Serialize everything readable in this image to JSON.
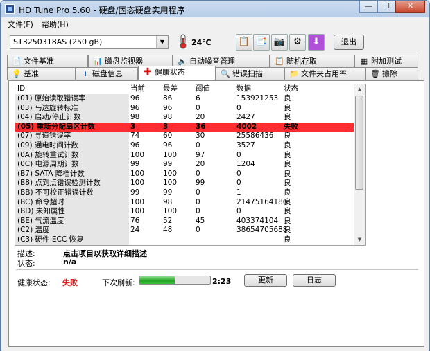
{
  "window": {
    "title": "HD Tune Pro 5.60 - 硬盘/固态硬盘实用程序"
  },
  "menu": {
    "file": "文件(F)",
    "help": "帮助(H)"
  },
  "toolbar": {
    "drive": "ST3250318AS (250 gB)",
    "temperature": "24℃",
    "exit_label": "退出"
  },
  "tabs_top": [
    {
      "label": "文件基准",
      "icon": "file-benchmark-icon"
    },
    {
      "label": "磁盘监视器",
      "icon": "disk-monitor-icon"
    },
    {
      "label": "自动噪音管理",
      "icon": "speaker-icon"
    },
    {
      "label": "随机存取",
      "icon": "random-access-icon"
    },
    {
      "label": "附加测试",
      "icon": "extra-tests-icon"
    }
  ],
  "tabs_bottom": [
    {
      "label": "基准",
      "icon": "lightbulb-icon"
    },
    {
      "label": "磁盘信息",
      "icon": "info-icon"
    },
    {
      "label": "健康状态",
      "icon": "red-cross-icon",
      "active": true
    },
    {
      "label": "错误扫描",
      "icon": "magnifier-icon"
    },
    {
      "label": "文件夹占用率",
      "icon": "folder-icon"
    },
    {
      "label": "擦除",
      "icon": "trash-icon"
    }
  ],
  "table": {
    "headers": [
      "ID",
      "当前",
      "最差",
      "阈值",
      "数据",
      "状态"
    ],
    "rows": [
      [
        "(01) 原始读取错误率",
        "96",
        "86",
        "6",
        "153921253",
        "良"
      ],
      [
        "(03) 马达旋转标准",
        "96",
        "96",
        "0",
        "0",
        "良"
      ],
      [
        "(04) 启动/停止计数",
        "98",
        "98",
        "20",
        "2427",
        "良"
      ],
      [
        "(05) 重新分配扇区计数",
        "3",
        "3",
        "36",
        "4002",
        "失败"
      ],
      [
        "(07) 寻道错误率",
        "74",
        "60",
        "30",
        "25586436",
        "良"
      ],
      [
        "(09) 通电时间计数",
        "96",
        "96",
        "0",
        "3527",
        "良"
      ],
      [
        "(0A) 旋转重试计数",
        "100",
        "100",
        "97",
        "0",
        "良"
      ],
      [
        "(0C) 电源周期计数",
        "99",
        "99",
        "20",
        "1204",
        "良"
      ],
      [
        "(B7) SATA 降档计数",
        "100",
        "100",
        "0",
        "0",
        "良"
      ],
      [
        "(B8) 点到点错误检测计数",
        "100",
        "100",
        "99",
        "0",
        "良"
      ],
      [
        "(BB) 不可校正错误计数",
        "99",
        "99",
        "0",
        "1",
        "良"
      ],
      [
        "(BC) 命令超时",
        "100",
        "98",
        "0",
        "21475164186",
        "良"
      ],
      [
        "(BD) 未知属性",
        "100",
        "100",
        "0",
        "0",
        "良"
      ],
      [
        "(BE) 气流温度",
        "76",
        "52",
        "45",
        "403374104",
        "良"
      ],
      [
        "(C2) 温度",
        "24",
        "48",
        "0",
        "38654705688",
        "良"
      ],
      [
        "(C3) 硬件 ECC 恢复",
        "",
        "",
        "",
        "",
        "良"
      ]
    ]
  },
  "details": {
    "desc_label": "描述:",
    "desc_value": "点击项目以获取详细描述",
    "status_label": "状态:",
    "status_value": "n/a"
  },
  "health": {
    "label": "健康状态:",
    "value": "失败",
    "refresh_label": "下次刷新:",
    "progress": 0.5,
    "countdown": "2:23",
    "refresh_button": "更新",
    "log_button": "日志"
  },
  "colors": {
    "fail_row": "#ff2d2d",
    "fail_text": "#e02020",
    "progress": "#22a422"
  }
}
